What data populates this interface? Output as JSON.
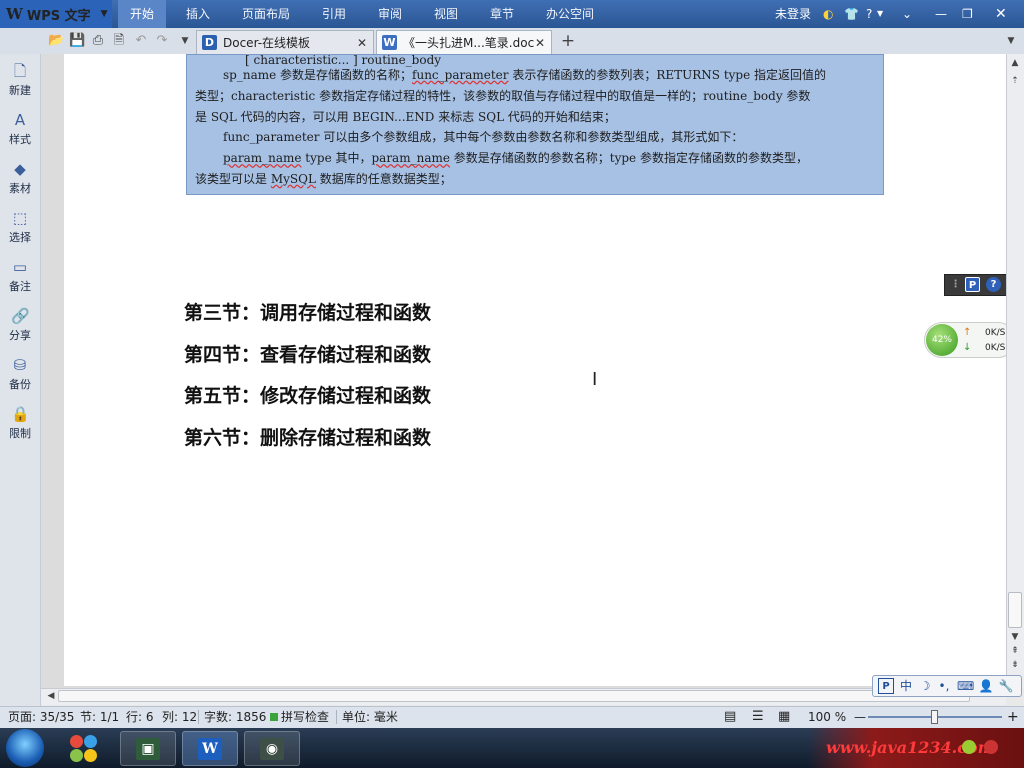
{
  "app": {
    "logo": "WPS 文字"
  },
  "menu": [
    {
      "label": "开始",
      "active": true
    },
    {
      "label": "插入"
    },
    {
      "label": "页面布局"
    },
    {
      "label": "引用"
    },
    {
      "label": "审阅"
    },
    {
      "label": "视图"
    },
    {
      "label": "章节"
    },
    {
      "label": "办公空间"
    }
  ],
  "account": {
    "login": "未登录",
    "help": "?"
  },
  "tabs": [
    {
      "label": "Docer-在线模板",
      "icon": "D"
    },
    {
      "label": "《一头扎进M...笔录.doc",
      "icon": "W"
    }
  ],
  "sidebar": [
    {
      "label": "新建"
    },
    {
      "label": "样式"
    },
    {
      "label": "素材"
    },
    {
      "label": "选择"
    },
    {
      "label": "备注"
    },
    {
      "label": "分享"
    },
    {
      "label": "备份"
    },
    {
      "label": "限制"
    }
  ],
  "note": {
    "line0": "[ characteristic... ] routine_body",
    "line1a": "sp_name 参数是存储函数的名称；",
    "line1b": "func_parameter",
    "line1c": " 表示存储函数的参数列表；RETURNS type 指定返回值的",
    "line2": "类型；characteristic 参数指定存储过程的特性，该参数的取值与存储过程中的取值是一样的；routine_body 参数",
    "line3": "是 SQL 代码的内容，可以用 BEGIN...END 来标志 SQL 代码的开始和结束；",
    "line4a": "func_parameter",
    "line4b": " 可以由多个参数组成，其中每个参数由参数名称和参数类型组成，其形式如下：",
    "line5a": "param_name",
    "line5b": " type      其中，",
    "line5c": "param_name",
    "line5d": " 参数是存储函数的参数名称；type 参数指定存储函数的参数类型，",
    "line6a": "该类型可以是 ",
    "line6b": "MySQL",
    "line6c": " 数据库的任意数据类型；"
  },
  "headings": [
    "第三节：调用存储过程和函数",
    "第四节：查看存储过程和函数",
    "第五节：修改存储过程和函数",
    "第六节：删除存储过程和函数"
  ],
  "net_widget": {
    "percent": "42%",
    "up": "0K/S",
    "down": "0K/S"
  },
  "ime": {
    "mode": "中"
  },
  "status": {
    "page": "页面: 35/35",
    "section": "节: 1/1",
    "row": "行: 6",
    "col": "列: 12",
    "words": "字数: 1856",
    "spell": "拼写检查",
    "unit": "单位: 毫米",
    "zoom": "100 %"
  },
  "watermark": "www.java1234.com",
  "colors": {
    "menubar": "#2b5694",
    "highlight": "#a7c1e4",
    "watermark": "#ff3a3a"
  }
}
